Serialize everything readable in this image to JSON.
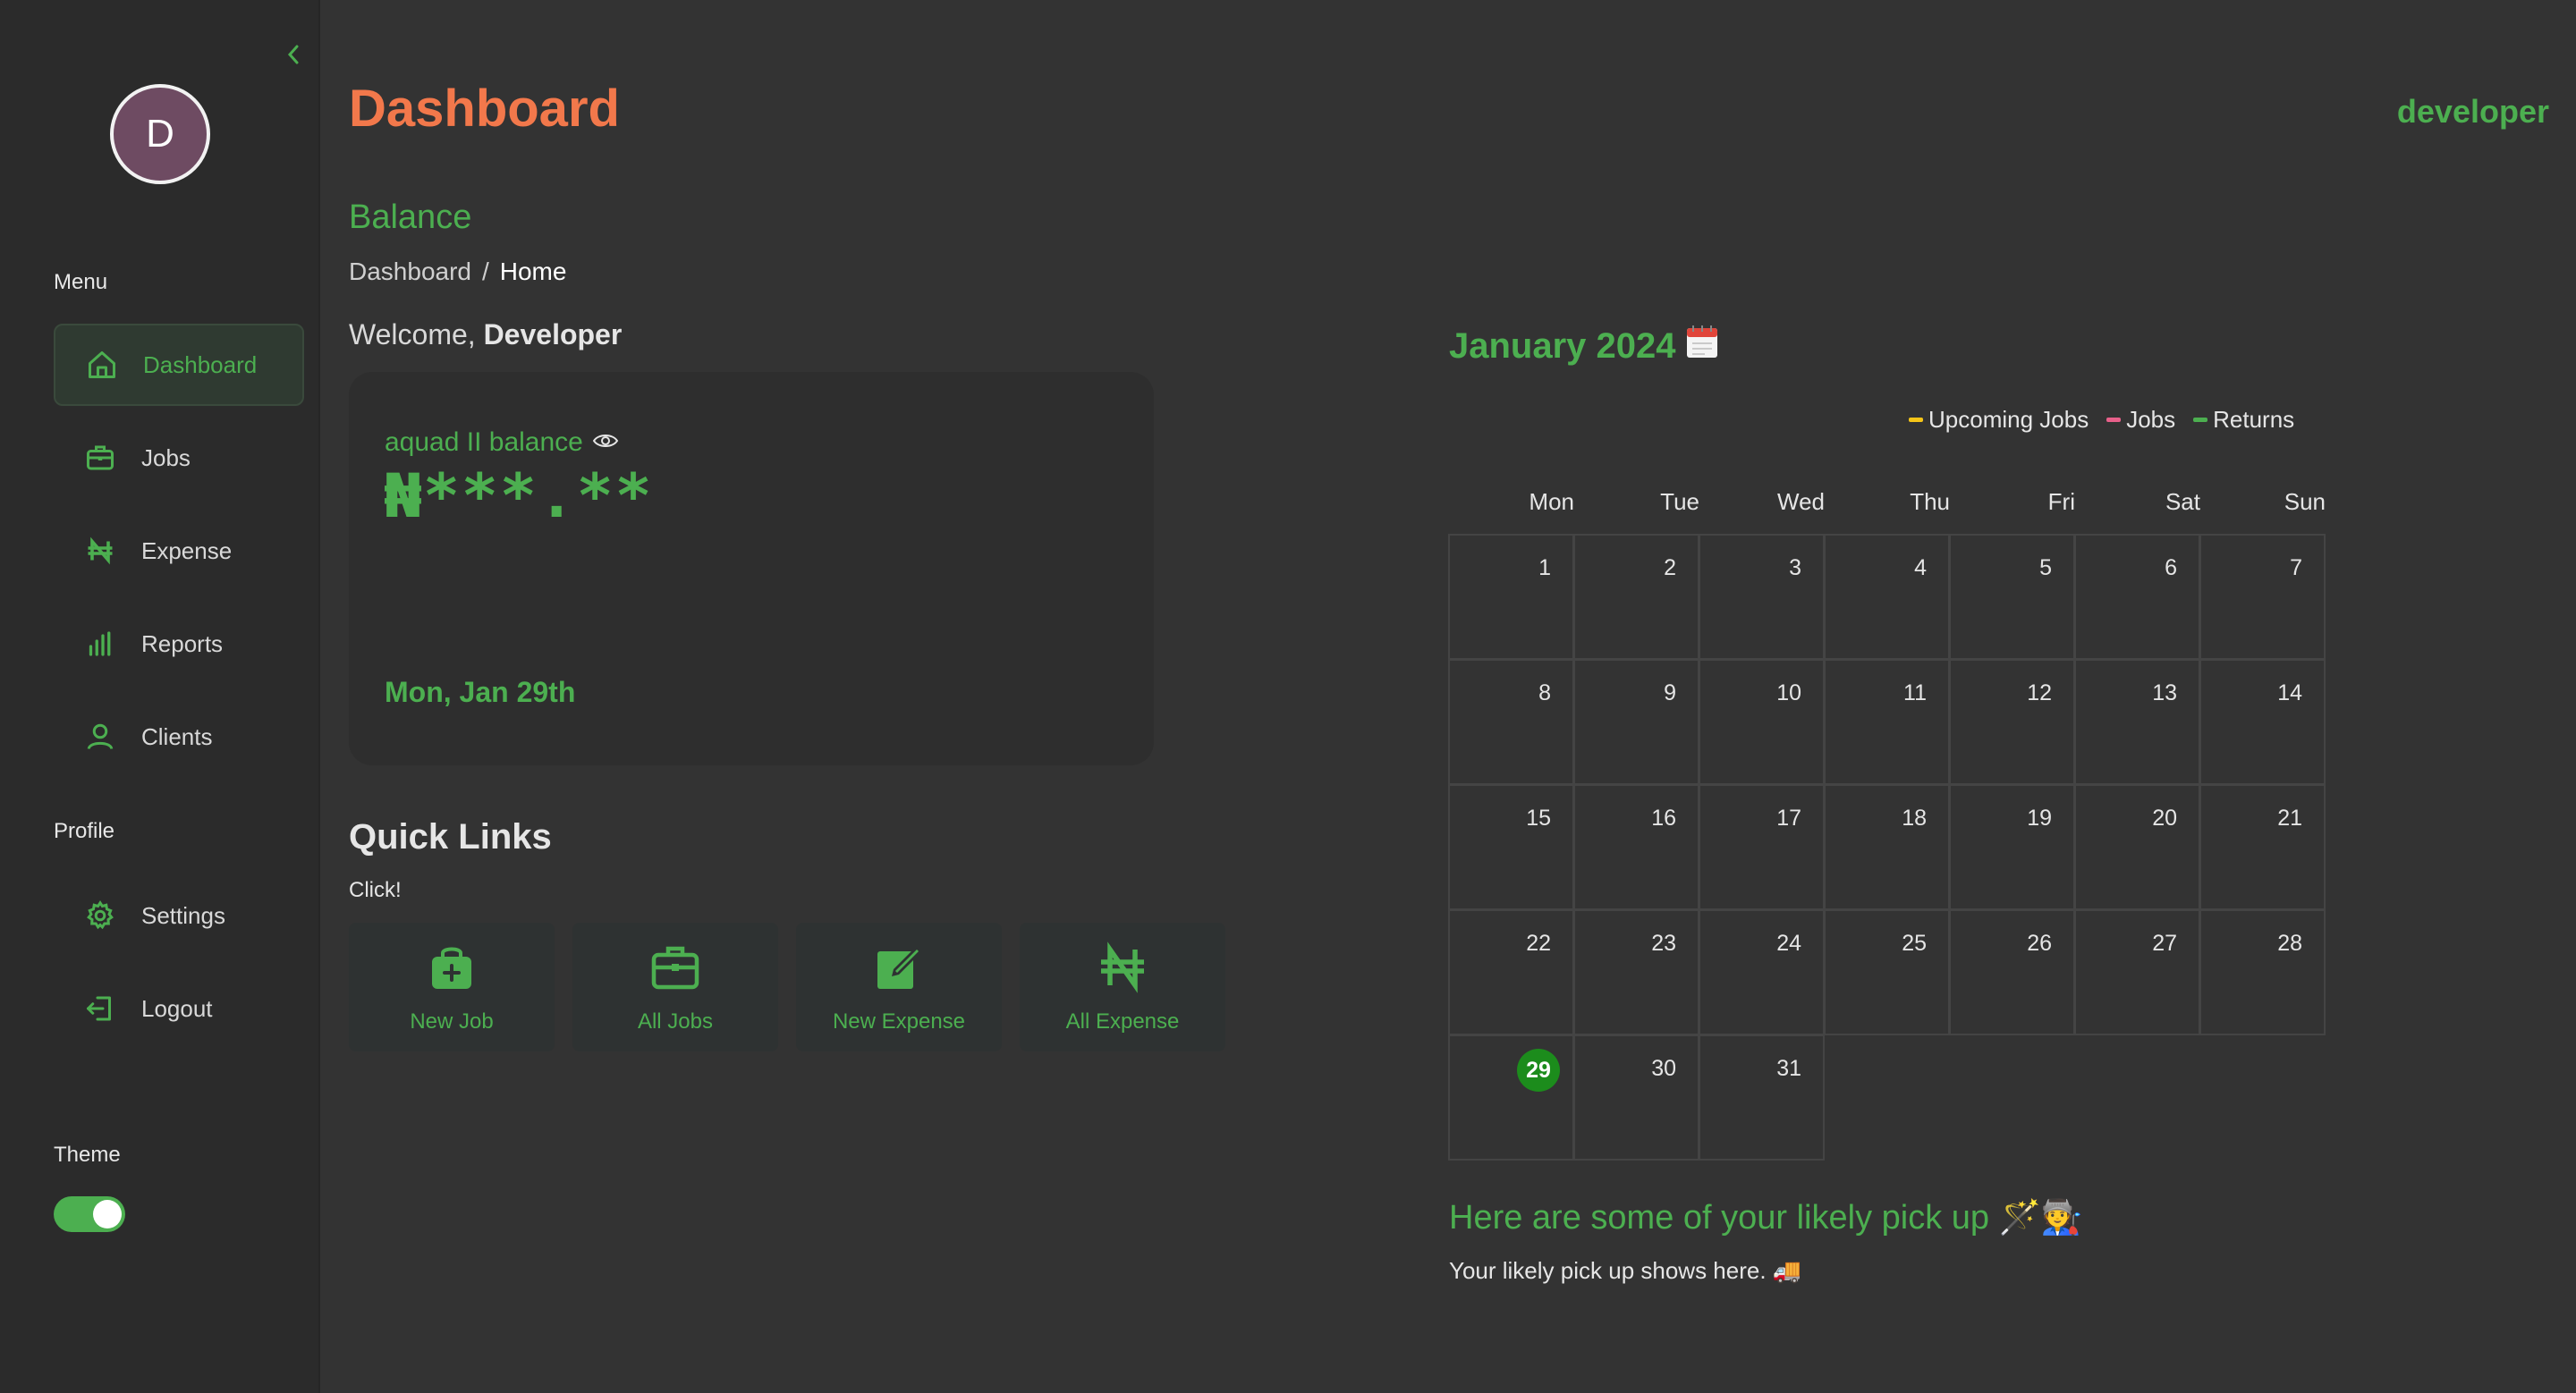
{
  "sidebar": {
    "avatar_initial": "D",
    "menu_label": "Menu",
    "items": [
      {
        "label": "Dashboard",
        "icon": "home-icon",
        "active": true
      },
      {
        "label": "Jobs",
        "icon": "briefcase-icon"
      },
      {
        "label": "Expense",
        "icon": "naira-icon"
      },
      {
        "label": "Reports",
        "icon": "bar-chart-icon"
      },
      {
        "label": "Clients",
        "icon": "user-icon"
      }
    ],
    "profile_label": "Profile",
    "profile_items": [
      {
        "label": "Settings",
        "icon": "gear-icon"
      },
      {
        "label": "Logout",
        "icon": "logout-icon"
      }
    ],
    "theme_label": "Theme",
    "theme_on": true
  },
  "header": {
    "title": "Dashboard",
    "user": "developer"
  },
  "balance": {
    "heading": "Balance",
    "breadcrumb": [
      "Dashboard",
      "/",
      "Home"
    ],
    "welcome_prefix": "Welcome,",
    "welcome_name": "Developer",
    "label": "aquad II balance",
    "amount": "₦***.**",
    "date": "Mon, Jan 29th"
  },
  "quick_links": {
    "title": "Quick Links",
    "subtitle": "Click!",
    "items": [
      {
        "label": "New Job",
        "icon": "bag-plus-icon"
      },
      {
        "label": "All Jobs",
        "icon": "briefcase-icon"
      },
      {
        "label": "New Expense",
        "icon": "edit-icon"
      },
      {
        "label": "All Expense",
        "icon": "naira-icon"
      }
    ]
  },
  "calendar": {
    "title": "January 2024",
    "legend": [
      {
        "label": "Upcoming Jobs",
        "color": "#f5c518"
      },
      {
        "label": "Jobs",
        "color": "#e8608a"
      },
      {
        "label": "Returns",
        "color": "#4caf50"
      }
    ],
    "weekdays": [
      "Mon",
      "Tue",
      "Wed",
      "Thu",
      "Fri",
      "Sat",
      "Sun"
    ],
    "days": [
      1,
      2,
      3,
      4,
      5,
      6,
      7,
      8,
      9,
      10,
      11,
      12,
      13,
      14,
      15,
      16,
      17,
      18,
      19,
      20,
      21,
      22,
      23,
      24,
      25,
      26,
      27,
      28,
      29,
      30,
      31
    ],
    "today": 29
  },
  "pickup": {
    "title": "Here are some of your likely pick up 🪄🧑‍🏭",
    "subtitle": "Your likely pick up shows here. 🚚"
  },
  "colors": {
    "accent": "#4caf50",
    "title": "#f2784b",
    "background": "#333333",
    "sidebar": "#2b2b2b"
  }
}
